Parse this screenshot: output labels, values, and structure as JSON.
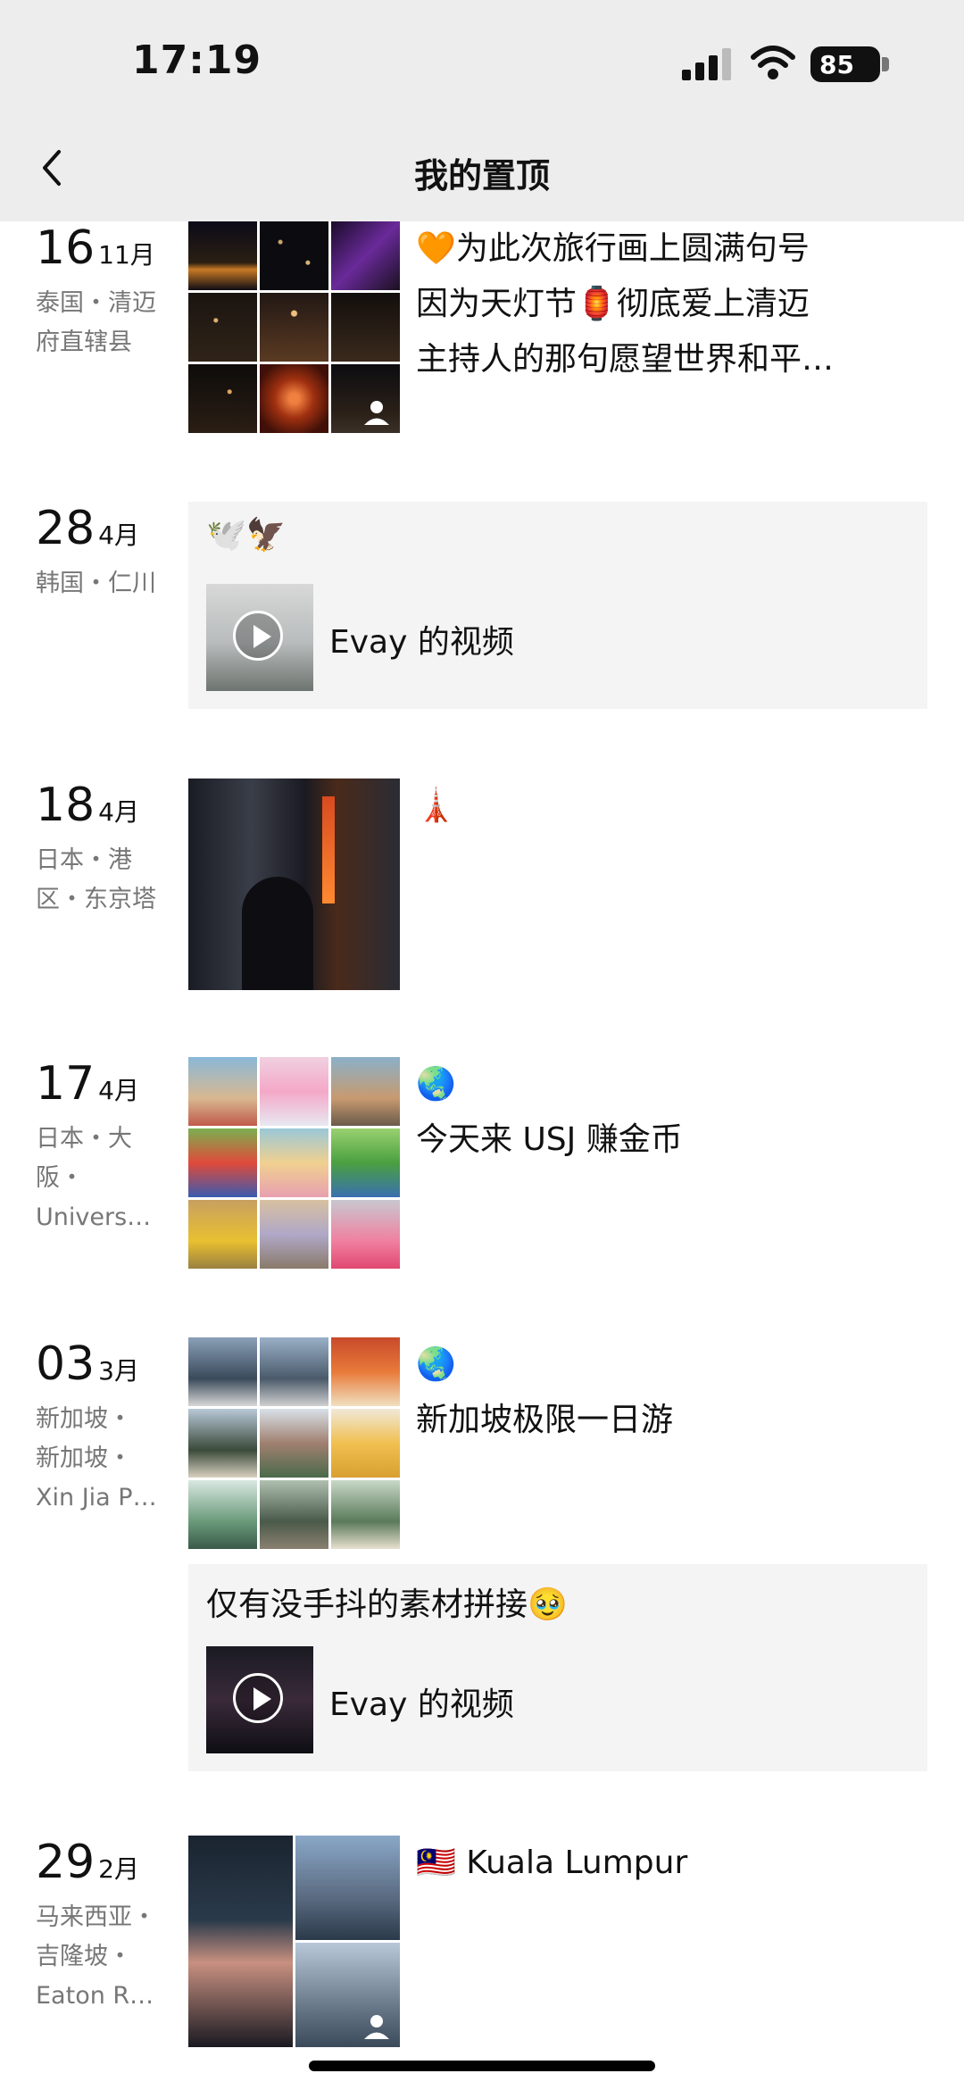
{
  "status": {
    "time": "17:19",
    "battery": "85"
  },
  "nav": {
    "title": "我的置顶"
  },
  "posts": [
    {
      "day": "16",
      "month": "11月",
      "location": "泰国・清迈府直辖县",
      "text_lines": [
        "🧡为此次旅行画上圆满句号",
        "因为天灯节🏮彻底爱上清迈",
        "主持人的那句愿望世界和平…"
      ]
    },
    {
      "day": "28",
      "month": "4月",
      "location": "韩国・仁川",
      "card_caption": "🕊️🦅",
      "video_label": "Evay 的视频"
    },
    {
      "day": "18",
      "month": "4月",
      "location": "日本・港区・东京塔",
      "text_lines": [
        "🗼"
      ]
    },
    {
      "day": "17",
      "month": "4月",
      "location_lines": [
        "日本・大",
        "阪・",
        "Univers…"
      ],
      "text_lines": [
        "🌏",
        "今天来 USJ 赚金币"
      ]
    },
    {
      "day": "03",
      "month": "3月",
      "location_lines": [
        "新加坡・",
        "新加坡・",
        "Xin Jia P…"
      ],
      "text_lines": [
        "🌏",
        "新加坡极限一日游"
      ],
      "card_caption": "仅有没手抖的素材拼接🥹",
      "video_label": "Evay 的视频"
    },
    {
      "day": "29",
      "month": "2月",
      "location_lines": [
        "马来西亚・",
        "吉隆坡・",
        "Eaton R…"
      ],
      "text_lines": [
        "🇲🇾 Kuala Lumpur"
      ]
    }
  ]
}
